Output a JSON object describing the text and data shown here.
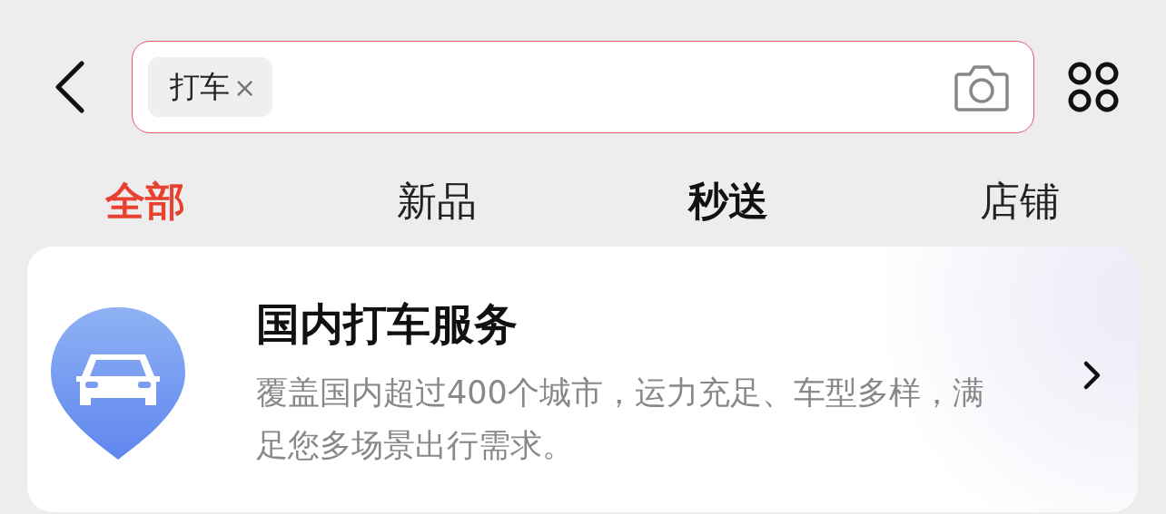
{
  "search": {
    "chips": [
      {
        "label": "打车",
        "remove": "×"
      }
    ]
  },
  "tabs": [
    {
      "label": "全部",
      "selected": true,
      "bold": false
    },
    {
      "label": "新品",
      "selected": false,
      "bold": false
    },
    {
      "label": "秒送",
      "selected": false,
      "bold": true
    },
    {
      "label": "店铺",
      "selected": false,
      "bold": false
    }
  ],
  "result": {
    "title": "国内打车服务",
    "description": "覆盖国内超过400个城市，运力充足、车型多样，满足您多场景出行需求。"
  }
}
